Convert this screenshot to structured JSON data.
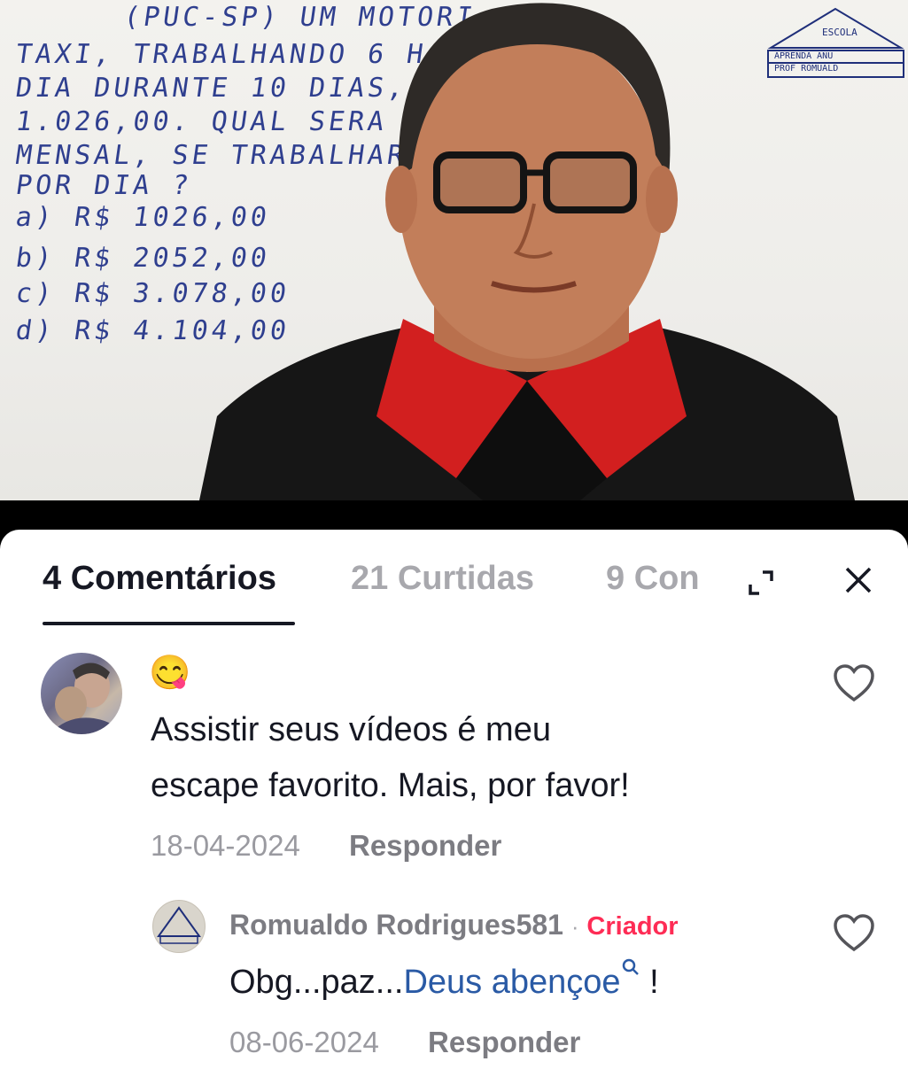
{
  "video": {
    "whiteboard_lines": [
      "(PUC-SP) UM MOTORI",
      "TAXI, TRABALHANDO 6 H",
      "DIA DURANTE 10 DIAS,",
      "1.026,00. QUAL SERA O S",
      "MENSAL, SE TRABALHAR",
      "POR DIA ?",
      "a) R$ 1026,00",
      "b) R$ 2052,00",
      "c) R$ 3.078,00",
      "d) R$ 4.104,00"
    ],
    "logo": {
      "line1": "ESCOLA",
      "line2": "APRENDA ANU",
      "line3": "PROF ROMUALD"
    }
  },
  "sheet": {
    "tabs": [
      {
        "label": "4 Comentários"
      },
      {
        "label": "21 Curtidas"
      },
      {
        "label": "9 Con"
      }
    ],
    "comments": [
      {
        "emoji": "😋",
        "text_lines": [
          "Assistir seus vídeos é meu",
          "escape favorito.  Mais, por favor!"
        ],
        "date": "18-04-2024",
        "reply_label": "Responder"
      }
    ],
    "reply": {
      "author": "Romualdo Rodrigues581",
      "separator": "·",
      "badge": "Criador",
      "text_prefix": "Obg...paz...",
      "text_link": "Deus abençoe",
      "text_suffix": " !",
      "date": "08-06-2024",
      "reply_label": "Responder"
    }
  },
  "colors": {
    "badge": "#fe2c55",
    "link": "#2a5aa5",
    "text": "#161823"
  }
}
